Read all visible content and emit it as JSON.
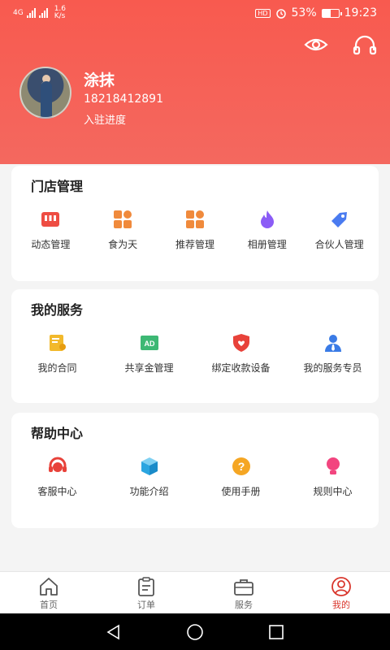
{
  "status_bar": {
    "network": "4G",
    "speed_value": "1.6",
    "speed_unit": "K/s",
    "hd": "HD",
    "battery": "53%",
    "battery_level": 0.53,
    "time": "19:23"
  },
  "profile": {
    "name": "涂抹",
    "phone": "18218412891",
    "progress_link": "入驻进度"
  },
  "store_management": {
    "title": "门店管理",
    "items": [
      {
        "label": "动态管理",
        "icon": "store-icon"
      },
      {
        "label": "食为天",
        "icon": "grid-icon"
      },
      {
        "label": "推荐管理",
        "icon": "grid-icon"
      },
      {
        "label": "相册管理",
        "icon": "flame-icon"
      },
      {
        "label": "合伙人管理",
        "icon": "tag-icon"
      }
    ]
  },
  "my_services": {
    "title": "我的服务",
    "items": [
      {
        "label": "我的合同",
        "icon": "contract-icon"
      },
      {
        "label": "共享金管理",
        "icon": "ad-icon"
      },
      {
        "label": "绑定收款设备",
        "icon": "shield-icon"
      },
      {
        "label": "我的服务专员",
        "icon": "agent-icon"
      }
    ]
  },
  "help_center": {
    "title": "帮助中心",
    "items": [
      {
        "label": "客服中心",
        "icon": "headset-icon"
      },
      {
        "label": "功能介绍",
        "icon": "cube-icon"
      },
      {
        "label": "使用手册",
        "icon": "question-icon"
      },
      {
        "label": "规则中心",
        "icon": "bulb-icon"
      }
    ]
  },
  "tabbar": {
    "tabs": [
      {
        "label": "首页",
        "icon": "home-icon"
      },
      {
        "label": "订单",
        "icon": "clipboard-icon"
      },
      {
        "label": "服务",
        "icon": "briefcase-icon"
      },
      {
        "label": "我的",
        "icon": "user-icon",
        "active": true
      }
    ]
  },
  "colors": {
    "header": "#f85a4f",
    "accent": "#d9362c",
    "orange": "#f08a3c",
    "purple": "#8b5cf6",
    "blue": "#4a7bf0"
  }
}
